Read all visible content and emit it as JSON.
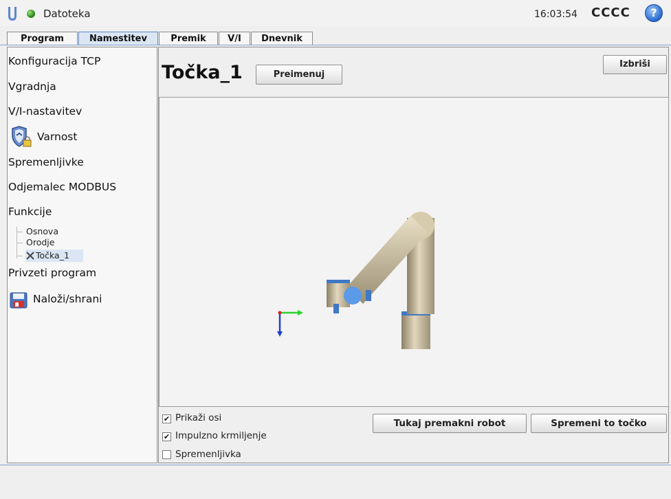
{
  "header": {
    "app_title": "Datoteka",
    "clock": "16:03:54",
    "robot_name": "CCCC",
    "help_glyph": "?",
    "status_color": "#2e8b1b"
  },
  "tabs": [
    {
      "label": "Program"
    },
    {
      "label": "Namestitev",
      "active": true
    },
    {
      "label": "Premik"
    },
    {
      "label": "V/I"
    },
    {
      "label": "Dnevnik"
    }
  ],
  "sidebar": {
    "items": [
      {
        "label": "Konfiguracija TCP"
      },
      {
        "label": "Vgradnja"
      },
      {
        "label": "V/I-nastavitev"
      },
      {
        "label": "Varnost",
        "icon": "shield-lock-icon"
      },
      {
        "label": "Spremenljivke"
      },
      {
        "label": "Odjemalec MODBUS"
      },
      {
        "label": "Funkcije"
      },
      {
        "label": "Privzeti program"
      },
      {
        "label": "Naloži/shrani",
        "icon": "floppy-disk-icon"
      }
    ],
    "features": [
      {
        "label": "Osnova"
      },
      {
        "label": "Orodje"
      },
      {
        "label": "Točka_1",
        "icon": "point-x-icon",
        "selected": true
      }
    ]
  },
  "main": {
    "title": "Točka_1",
    "rename_button": "Preimenuj",
    "delete_button": "Izbriši",
    "checkboxes": [
      {
        "label": "Prikaži osi",
        "checked": true
      },
      {
        "label": "Impulzno krmiljenje",
        "checked": true
      },
      {
        "label": "Spremenljivka",
        "checked": false
      }
    ],
    "move_here_button": "Tukaj premakni robot",
    "change_point_button": "Spremeni to točko"
  }
}
